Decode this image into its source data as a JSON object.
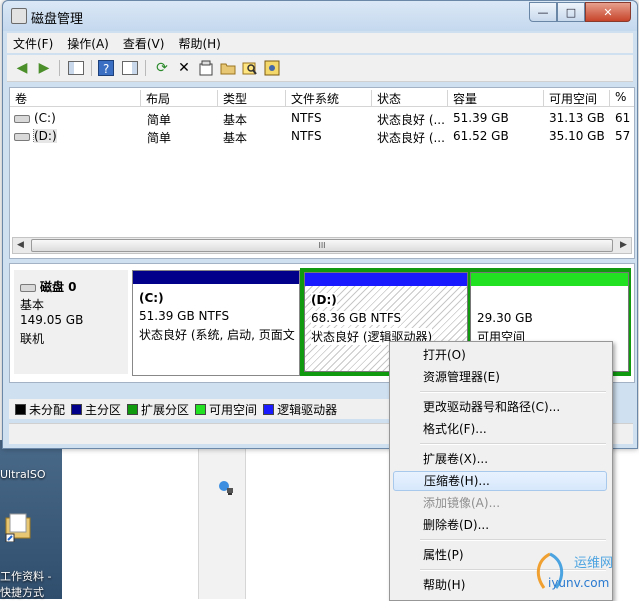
{
  "window": {
    "title": "磁盘管理",
    "buttons": {
      "minimize": "—",
      "maximize": "□",
      "close": "✕"
    }
  },
  "menubar": [
    "文件(F)",
    "操作(A)",
    "查看(V)",
    "帮助(H)"
  ],
  "table": {
    "headers": [
      "卷",
      "布局",
      "类型",
      "文件系统",
      "状态",
      "容量",
      "可用空间",
      "%"
    ],
    "rows": [
      [
        "(C:)",
        "简单",
        "基本",
        "NTFS",
        "状态良好 (...",
        "51.39 GB",
        "31.13 GB",
        "61"
      ],
      [
        "(D:)",
        "简单",
        "基本",
        "NTFS",
        "状态良好 (...",
        "61.52 GB",
        "35.10 GB",
        "57"
      ]
    ],
    "scroll_label": "III"
  },
  "disk": {
    "name": "磁盘 0",
    "type": "基本",
    "size": "149.05 GB",
    "status": "联机"
  },
  "partitions": {
    "c": {
      "name": "(C:)",
      "size": "51.39 GB NTFS",
      "status": "状态良好 (系统, 启动, 页面文"
    },
    "d": {
      "name": "(D:)",
      "size": "68.36 GB NTFS",
      "status": "状态良好 (逻辑驱动器)"
    },
    "free": {
      "size": "29.30 GB",
      "status": "可用空间"
    }
  },
  "legend": [
    {
      "label": "未分配",
      "color": "#000000"
    },
    {
      "label": "主分区",
      "color": "#00008b"
    },
    {
      "label": "扩展分区",
      "color": "#109a10"
    },
    {
      "label": "可用空间",
      "color": "#22e022"
    },
    {
      "label": "逻辑驱动器",
      "color": "#1a1aff"
    }
  ],
  "context_menu": {
    "items": [
      {
        "label": "打开(O)",
        "enabled": true
      },
      {
        "label": "资源管理器(E)",
        "enabled": true
      },
      {
        "label": "更改驱动器号和路径(C)...",
        "enabled": true
      },
      {
        "label": "格式化(F)...",
        "enabled": true
      },
      {
        "label": "扩展卷(X)...",
        "enabled": true
      },
      {
        "label": "压缩卷(H)...",
        "enabled": true,
        "highlighted": true
      },
      {
        "label": "添加镜像(A)...",
        "enabled": false
      },
      {
        "label": "删除卷(D)...",
        "enabled": true
      },
      {
        "label": "属性(P)",
        "enabled": true
      },
      {
        "label": "帮助(H)",
        "enabled": true
      }
    ]
  },
  "desktop": {
    "label_ultraiso": "UltraISO",
    "label_folder_1": "工作资料 -",
    "label_folder_2": "快捷方式"
  },
  "watermark": {
    "site": "运维网",
    "url": "iyunv.com"
  }
}
